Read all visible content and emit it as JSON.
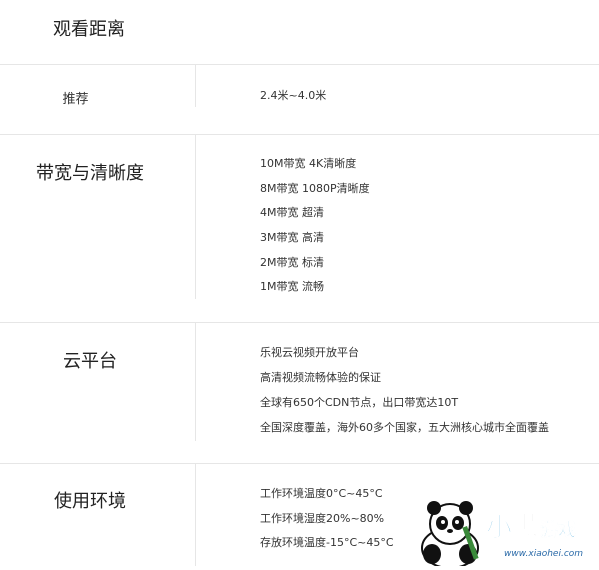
{
  "sections": [
    {
      "title": "观看距离",
      "values": []
    },
    {
      "title": "推荐",
      "values": [
        "2.4米~4.0米"
      ]
    },
    {
      "title": "带宽与清晰度",
      "values": [
        "10M带宽 4K清晰度",
        "8M带宽 1080P清晰度",
        "4M带宽 超清",
        "3M带宽 高清",
        "2M带宽 标清",
        "1M带宽 流畅"
      ]
    },
    {
      "title": "云平台",
      "values": [
        "乐视云视频开放平台",
        "高清视频流畅体验的保证",
        "全球有650个CDN节点，出口带宽达10T",
        "全国深度覆盖，海外60多个国家，五大洲核心城市全面覆盖"
      ]
    },
    {
      "title": "使用环境",
      "values": [
        "工作环境温度0°C~45°C",
        "工作环境湿度20%~80%",
        "存放环境温度-15°C~45°C"
      ]
    }
  ],
  "watermark": {
    "brand_text": "小黑游戏",
    "url_text": "www.xiaohei.com",
    "mascot_icon": "panda-icon"
  }
}
